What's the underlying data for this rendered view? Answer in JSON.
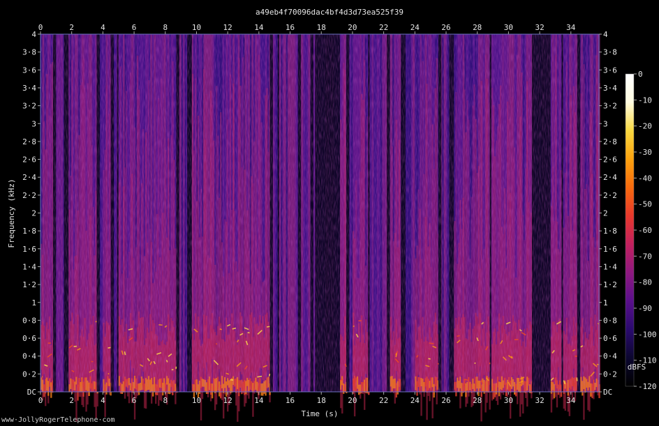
{
  "chart_data": {
    "type": "heatmap",
    "title": "a49eb4f70096dac4bf4d3d73ea525f39",
    "xlabel": "Time (s)",
    "ylabel": "Frequency (kHz)",
    "xlim": [
      0,
      35.8
    ],
    "ylim": [
      0,
      4
    ],
    "x_ticks": [
      0,
      2,
      4,
      6,
      8,
      10,
      12,
      14,
      16,
      18,
      20,
      22,
      24,
      26,
      28,
      30,
      32,
      34
    ],
    "x_tick_labels": [
      "0",
      "2",
      "4",
      "6",
      "8",
      "10",
      "12",
      "14",
      "16",
      "18",
      "20",
      "22",
      "24",
      "26",
      "28",
      "30",
      "32",
      "34"
    ],
    "y_ticks": [
      0,
      0.2,
      0.4,
      0.6,
      0.8,
      1.0,
      1.2,
      1.4,
      1.6,
      1.8,
      2.0,
      2.2,
      2.4,
      2.6,
      2.8,
      3.0,
      3.2,
      3.4,
      3.6,
      3.8,
      4.0
    ],
    "y_tick_labels": [
      "DC",
      "0·2",
      "0·4",
      "0·6",
      "0·8",
      "1",
      "1·2",
      "1·4",
      "1·6",
      "1·8",
      "2",
      "2·2",
      "2·4",
      "2·6",
      "2·8",
      "3",
      "3·2",
      "3·4",
      "3·6",
      "3·8",
      "4"
    ],
    "colorbar": {
      "label": "dBFS",
      "range": [
        -120,
        0
      ],
      "ticks": [
        0,
        -10,
        -20,
        -30,
        -40,
        -50,
        -60,
        -70,
        -80,
        -90,
        -100,
        -110,
        -120
      ],
      "tick_labels": [
        "0",
        "-10",
        "-20",
        "-30",
        "-40",
        "-50",
        "-60",
        "-70",
        "-80",
        "-90",
        "-100",
        "-110",
        "-120"
      ],
      "colors": [
        "#000000",
        "#0c0730",
        "#2a0a6e",
        "#5a0f8c",
        "#8e1880",
        "#c2205e",
        "#e8382c",
        "#f86a0d",
        "#fca20e",
        "#f8d840",
        "#fffbe0",
        "#ffffff"
      ]
    },
    "silent_segments_s": [
      [
        0.8,
        1.0
      ],
      [
        1.5,
        1.8
      ],
      [
        3.6,
        3.8
      ],
      [
        4.5,
        4.7
      ],
      [
        4.9,
        5.0
      ],
      [
        8.7,
        8.9
      ],
      [
        9.4,
        9.7
      ],
      [
        14.7,
        14.9
      ],
      [
        15.2,
        15.3
      ],
      [
        16.5,
        16.7
      ],
      [
        17.3,
        17.5
      ],
      [
        17.6,
        19.2
      ],
      [
        19.6,
        19.8
      ],
      [
        21.0,
        21.1
      ],
      [
        22.2,
        22.4
      ],
      [
        23.1,
        23.4
      ],
      [
        25.5,
        25.7
      ],
      [
        26.2,
        26.5
      ],
      [
        28.8,
        28.9
      ],
      [
        31.5,
        31.7
      ],
      [
        31.7,
        32.7
      ],
      [
        33.4,
        33.5
      ],
      [
        34.4,
        34.6
      ]
    ],
    "voiced_segments_s": [
      [
        0.0,
        0.8
      ],
      [
        1.8,
        3.6
      ],
      [
        4.0,
        4.5
      ],
      [
        5.0,
        8.7
      ],
      [
        9.7,
        14.7
      ],
      [
        19.2,
        19.6
      ],
      [
        20.0,
        21.0
      ],
      [
        22.4,
        23.1
      ],
      [
        24.0,
        25.5
      ],
      [
        26.5,
        28.8
      ],
      [
        28.9,
        31.5
      ],
      [
        32.7,
        33.4
      ],
      [
        33.5,
        34.4
      ],
      [
        34.6,
        35.8
      ]
    ]
  },
  "credit": "www·JollyRogerTelephone·com"
}
